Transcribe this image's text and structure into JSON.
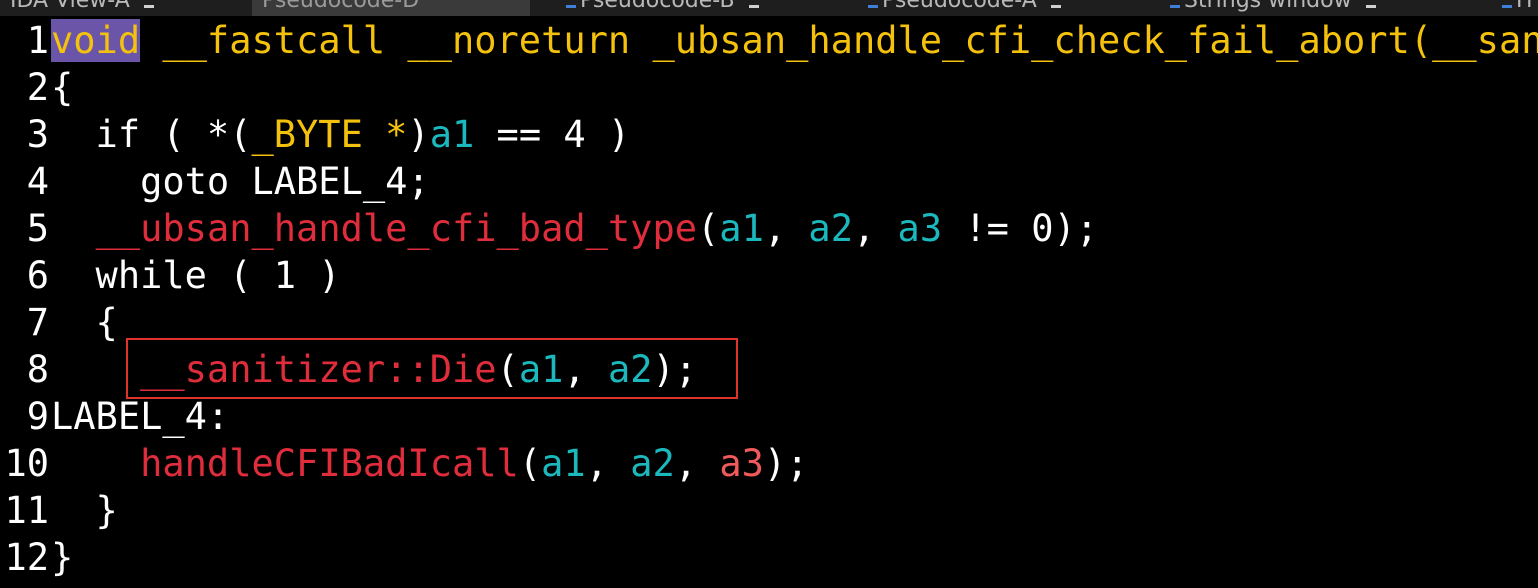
{
  "tabs": [
    {
      "label": "IDA View-A",
      "icon": "ida-view-icon",
      "active": false
    },
    {
      "label": "Pseudocode-D",
      "icon": "pseudocode-icon",
      "active": true
    },
    {
      "label": "Pseudocode-B",
      "icon": "pseudocode-icon",
      "active": false
    },
    {
      "label": "Pseudocode-A",
      "icon": "pseudocode-icon",
      "active": false
    },
    {
      "label": "Strings window",
      "icon": "strings-icon",
      "active": false
    },
    {
      "label": "H",
      "icon": "hex-icon",
      "active": false
    }
  ],
  "colors": {
    "background": "#000000",
    "keyword": "#f4c20d",
    "variable": "#1bb8bd",
    "function": "#e02d3c",
    "highlight_box": "#e0332b",
    "selection": "#6b55a8"
  },
  "code": {
    "lines": [
      {
        "n": "1",
        "tokens": [
          {
            "t": "void",
            "c": "kw-type kw-sel"
          },
          {
            "t": " __fastcall __noreturn _ubsan_handle_cfi_check_fail_abort(__sanitizer::CFICheckFailData *",
            "c": "c-yel"
          }
        ]
      },
      {
        "n": "2",
        "tokens": [
          {
            "t": "{",
            "c": "c-white"
          }
        ]
      },
      {
        "n": "3",
        "tokens": [
          {
            "t": "  if ( *(",
            "c": "c-white"
          },
          {
            "t": "_BYTE *",
            "c": "c-yel"
          },
          {
            "t": ")",
            "c": "c-white"
          },
          {
            "t": "a1",
            "c": "c-teal"
          },
          {
            "t": " == 4 )",
            "c": "c-white"
          }
        ]
      },
      {
        "n": "4",
        "tokens": [
          {
            "t": "    goto LABEL_4;",
            "c": "c-white"
          }
        ]
      },
      {
        "n": "5",
        "tokens": [
          {
            "t": "  ",
            "c": "c-white"
          },
          {
            "t": "__ubsan_handle_cfi_bad_type",
            "c": "c-red"
          },
          {
            "t": "(",
            "c": "c-white"
          },
          {
            "t": "a1",
            "c": "c-teal"
          },
          {
            "t": ", ",
            "c": "c-white"
          },
          {
            "t": "a2",
            "c": "c-teal"
          },
          {
            "t": ", ",
            "c": "c-white"
          },
          {
            "t": "a3",
            "c": "c-teal"
          },
          {
            "t": " != 0);",
            "c": "c-white"
          }
        ]
      },
      {
        "n": "6",
        "tokens": [
          {
            "t": "  while ( 1 )",
            "c": "c-white"
          }
        ]
      },
      {
        "n": "7",
        "tokens": [
          {
            "t": "  {",
            "c": "c-white"
          }
        ]
      },
      {
        "n": "8",
        "tokens": [
          {
            "t": "    ",
            "c": "c-white"
          },
          {
            "t": "__sanitizer::Die",
            "c": "c-red"
          },
          {
            "t": "(",
            "c": "c-white"
          },
          {
            "t": "a1",
            "c": "c-teal"
          },
          {
            "t": ", ",
            "c": "c-white"
          },
          {
            "t": "a2",
            "c": "c-teal"
          },
          {
            "t": ");",
            "c": "c-white"
          }
        ]
      },
      {
        "n": "9",
        "tokens": [
          {
            "t": "LABEL_4:",
            "c": "c-white"
          }
        ]
      },
      {
        "n": "10",
        "tokens": [
          {
            "t": "    ",
            "c": "c-white"
          },
          {
            "t": "handleCFIBadIcall",
            "c": "c-red"
          },
          {
            "t": "(",
            "c": "c-white"
          },
          {
            "t": "a1",
            "c": "c-teal"
          },
          {
            "t": ", ",
            "c": "c-white"
          },
          {
            "t": "a2",
            "c": "c-teal"
          },
          {
            "t": ", ",
            "c": "c-white"
          },
          {
            "t": "a3",
            "c": "c-pink"
          },
          {
            "t": ");",
            "c": "c-white"
          }
        ]
      },
      {
        "n": "11",
        "tokens": [
          {
            "t": "  }",
            "c": "c-white"
          }
        ]
      },
      {
        "n": "12",
        "tokens": [
          {
            "t": "}",
            "c": "c-white"
          }
        ]
      }
    ]
  }
}
